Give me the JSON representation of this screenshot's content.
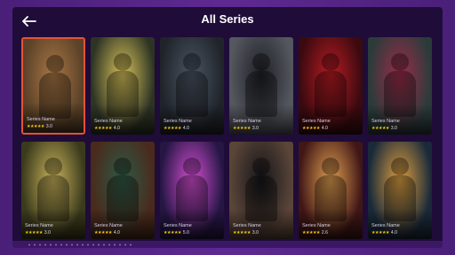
{
  "header": {
    "title": "All Series",
    "back_icon": "arrow-left-icon"
  },
  "series": [
    {
      "name": "Series Name",
      "rating": "3.0",
      "stars": 5,
      "bg": "#5c4228",
      "accent": "#a87745"
    },
    {
      "name": "Series Name",
      "rating": "4.0",
      "stars": 5,
      "bg": "#2d3424",
      "accent": "#d8c25a"
    },
    {
      "name": "Series Name",
      "rating": "4.0",
      "stars": 5,
      "bg": "#20242a",
      "accent": "#4b5563"
    },
    {
      "name": "Series Name",
      "rating": "3.0",
      "stars": 5,
      "bg": "#55575f",
      "accent": "#1d1f25"
    },
    {
      "name": "Series Name",
      "rating": "4.0",
      "stars": 5,
      "bg": "#3a0a0f",
      "accent": "#b81c24"
    },
    {
      "name": "Series Name",
      "rating": "3.0",
      "stars": 5,
      "bg": "#2b3b3a",
      "accent": "#9b2c4a"
    },
    {
      "name": "Series Name",
      "rating": "3.0",
      "stars": 5,
      "bg": "#3a3a1c",
      "accent": "#c9b35a"
    },
    {
      "name": "Series Name",
      "rating": "4.0",
      "stars": 5,
      "bg": "#4a2a1c",
      "accent": "#2e5a46"
    },
    {
      "name": "Series Name",
      "rating": "5.0",
      "stars": 5,
      "bg": "#251644",
      "accent": "#d44ed2"
    },
    {
      "name": "Series Name",
      "rating": "3.0",
      "stars": 5,
      "bg": "#5a4538",
      "accent": "#15151a"
    },
    {
      "name": "Series Name",
      "rating": "2.6",
      "stars": 5,
      "bg": "#401616",
      "accent": "#e0a050"
    },
    {
      "name": "Series Name",
      "rating": "4.0",
      "stars": 5,
      "bg": "#1a2a3a",
      "accent": "#e0a040"
    }
  ],
  "colors": {
    "background": "#5e2a92",
    "panel": "#1f0c38",
    "selected_border": "#e2533a",
    "star": "#f5c518"
  }
}
